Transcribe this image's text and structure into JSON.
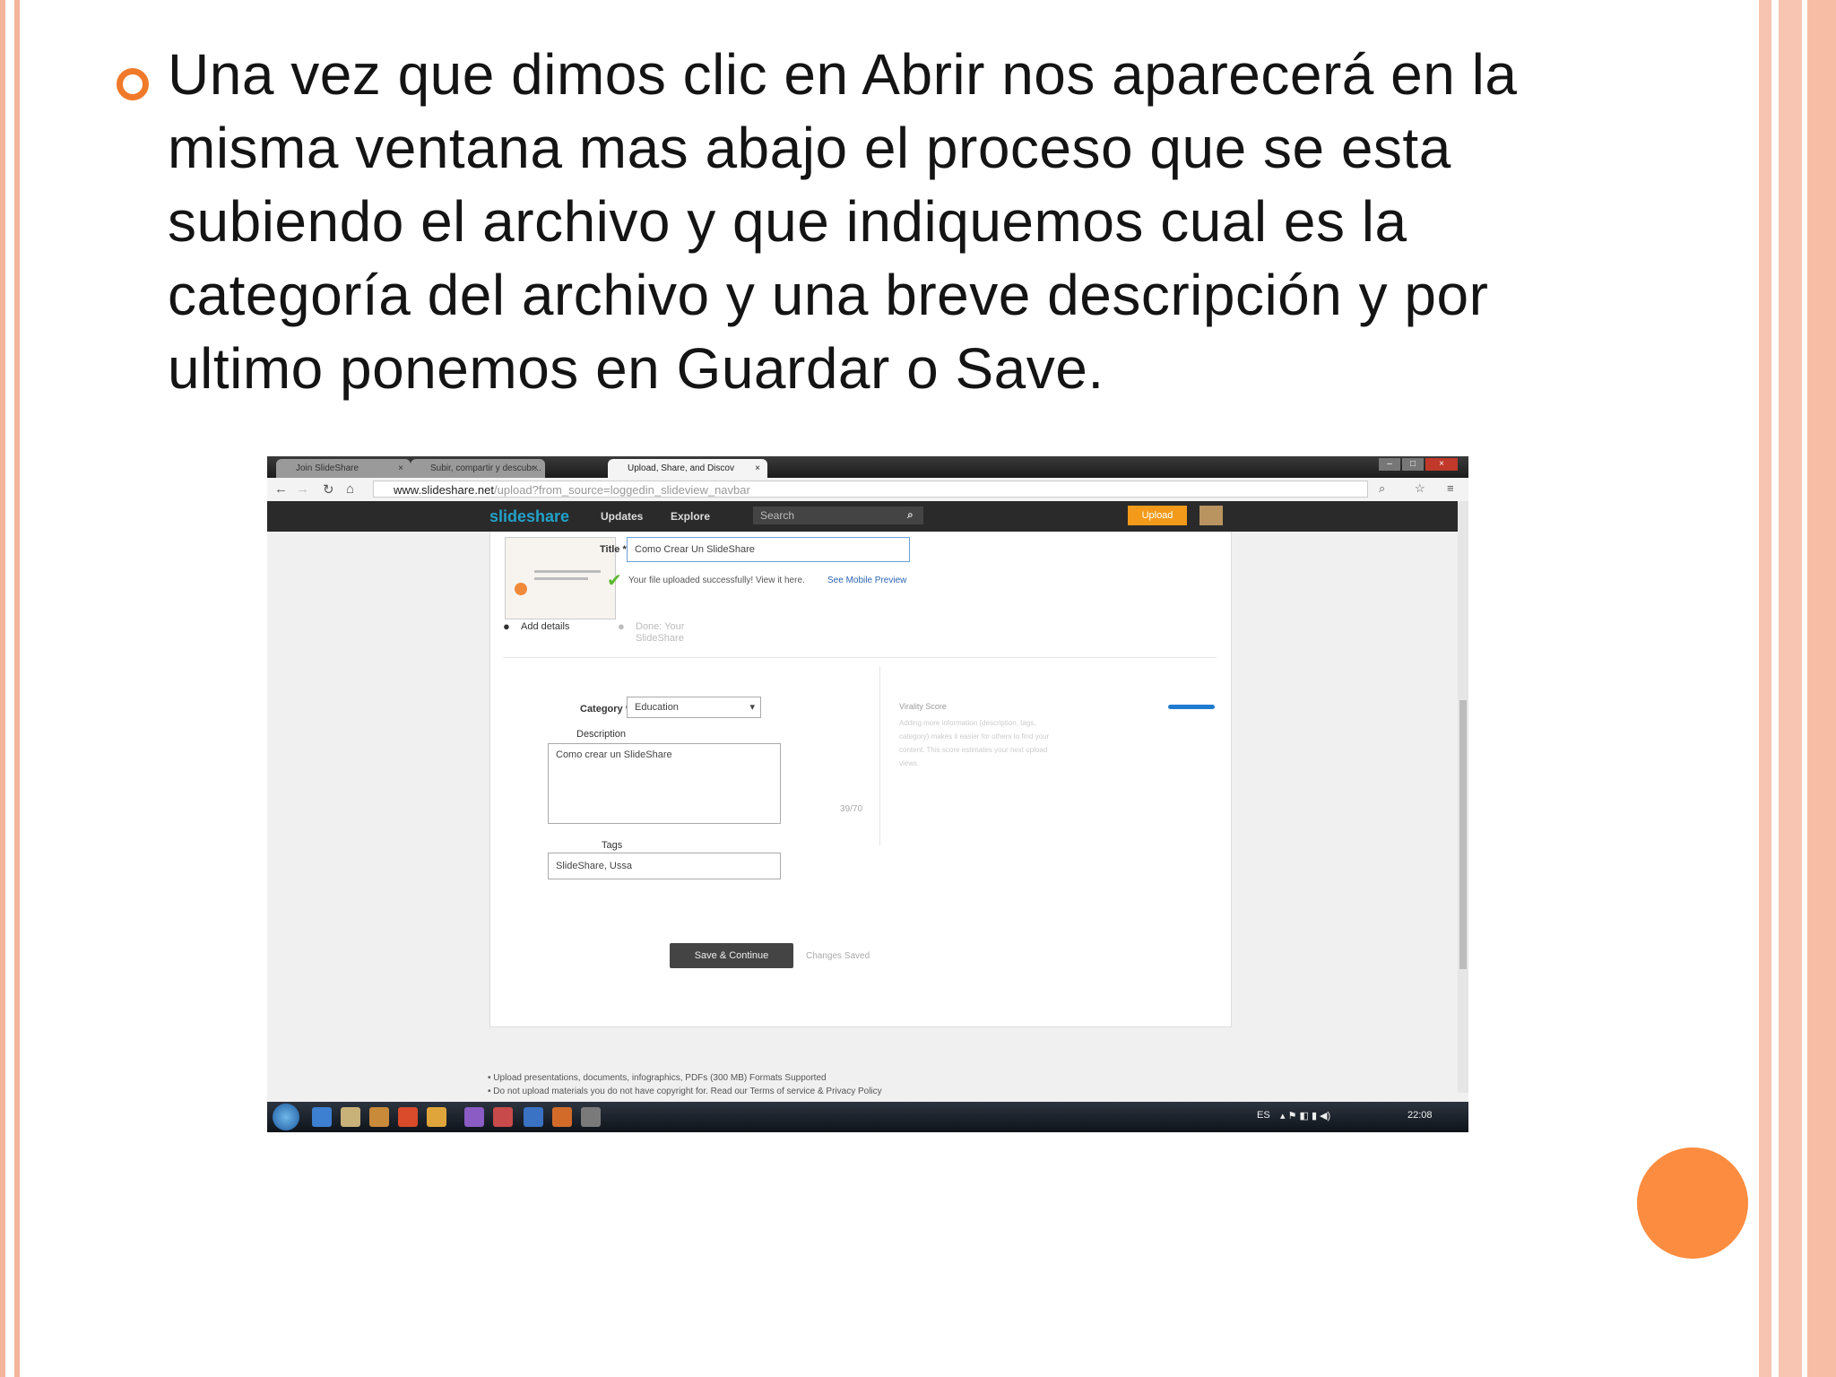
{
  "slide": {
    "paragraph": "Una vez que dimos clic en Abrir nos aparecerá en la misma ventana mas abajo el proceso que se esta subiendo el archivo y que indiquemos cual es la categoría del archivo y una breve descripción y por ultimo ponemos en Guardar o Save.",
    "accent_color": "#f07a2a",
    "frame_color": "#f4b49a",
    "circle_color": "#fc8c3f"
  },
  "screenshot": {
    "tabs": [
      {
        "label": "Join SlideShare"
      },
      {
        "label": "Subir, compartir y descubr..."
      },
      {
        "label": "Upload, Share, and Discov"
      }
    ],
    "url_host": "www.slideshare.net",
    "url_path": "/upload?from_source=loggedin_slideview_navbar",
    "nav": {
      "logo": "slideshare",
      "updates": "Updates",
      "explore": "Explore",
      "search_placeholder": "Search",
      "upload": "Upload"
    },
    "form": {
      "title_label": "Title *",
      "title_value": "Como Crear Un SlideShare",
      "upload_success": "Your file uploaded successfully! View it here.",
      "mobile_preview": "See Mobile Preview",
      "step1": "Add details",
      "step2": "Done: Your SlideShare",
      "category_label": "Category *",
      "category_value": "Education",
      "description_label": "Description",
      "description_value": "Como crear un SlideShare",
      "char_count": "39/70",
      "tags_label": "Tags",
      "tags_value": "SlideShare, Ussa",
      "save_button": "Save & Continue",
      "changes_saved": "Changes Saved",
      "virality_label": "Virality Score",
      "virality_help": "Adding more information (description, tags, category) makes it easier for others to find your content. This score estimates your next upload views."
    },
    "footnotes": [
      "Upload presentations, documents, infographics, PDFs (300 MB) Formats Supported",
      "Do not upload materials you do not have copyright for. Read our Terms of service & Privacy Policy"
    ],
    "tray": {
      "lang": "ES",
      "time": "22:08"
    }
  }
}
